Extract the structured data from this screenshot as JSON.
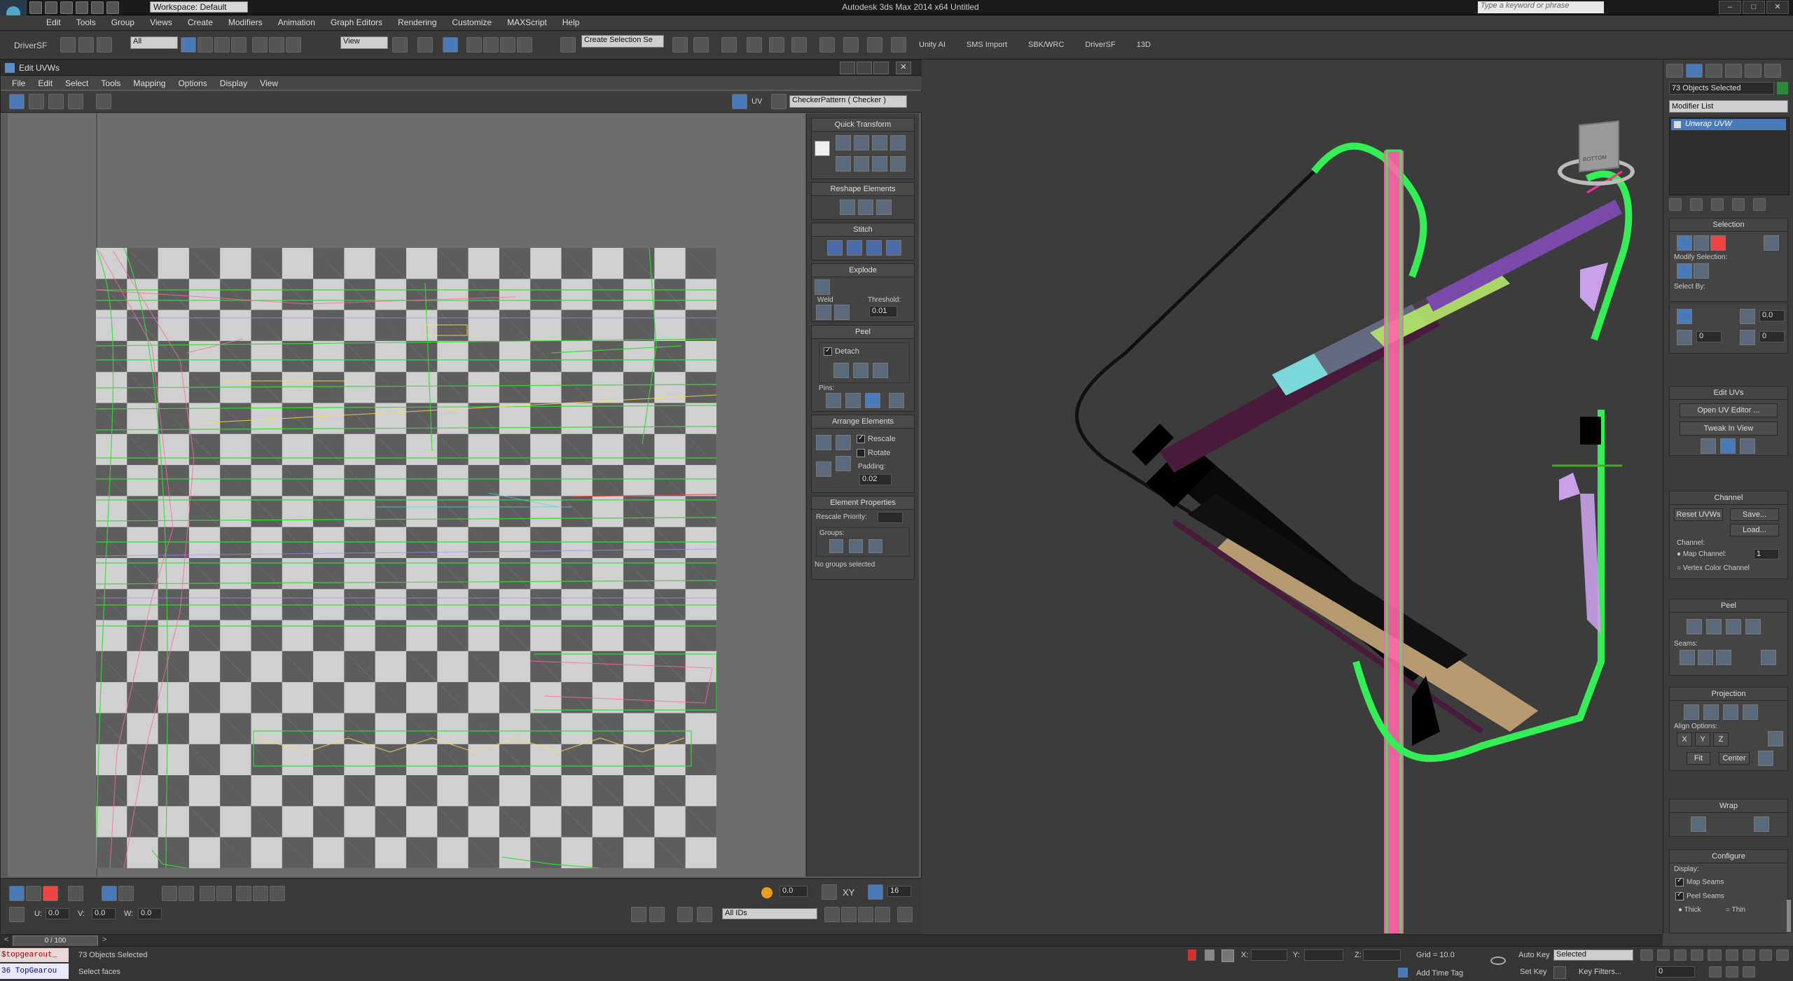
{
  "app": {
    "title": "Autodesk 3ds Max 2014 x64    Untitled",
    "workspace": "Workspace: Default",
    "search_placeholder": "Type a keyword or phrase"
  },
  "menu": [
    "Edit",
    "Tools",
    "Group",
    "Views",
    "Create",
    "Modifiers",
    "Animation",
    "Graph Editors",
    "Rendering",
    "Customize",
    "MAXScript",
    "Help"
  ],
  "toolbar": {
    "left_label": "DriverSF",
    "filter": "All",
    "view": "View",
    "selection_set": "Create Selection Se",
    "tabs": [
      "Unity AI",
      "SMS Import",
      "SBK/WRC",
      "DriverSF",
      "13D"
    ]
  },
  "uvw": {
    "title": "Edit UVWs",
    "menu": [
      "File",
      "Edit",
      "Select",
      "Tools",
      "Mapping",
      "Options",
      "Display",
      "View"
    ],
    "uv_label": "UV",
    "texture_dropdown": "CheckerPattern  ( Checker )",
    "quick_transform": "Quick Transform",
    "reshape": "Reshape Elements",
    "stitch": "Stitch",
    "explode": "Explode",
    "weld": "Weld",
    "threshold_label": "Threshold:",
    "threshold": "0.01",
    "peel": "Peel",
    "detach": "Detach",
    "pins": "Pins:",
    "arrange": "Arrange Elements",
    "rescale": "Rescale",
    "rotate": "Rotate",
    "padding_label": "Padding:",
    "padding": "0.02",
    "element_props": "Element Properties",
    "rescale_priority": "Rescale Priority:",
    "groups": "Groups:",
    "no_groups": "No groups selected",
    "bottom": {
      "value1": "0.0",
      "xy": "XY",
      "zoom": "16",
      "u_label": "U:",
      "u": "0.0",
      "v_label": "V:",
      "v": "0.0",
      "w_label": "W:",
      "w": "0.0",
      "ids": "All IDs"
    }
  },
  "command_panel": {
    "objects_selected": "73 Objects Selected",
    "modifier_list": "Modifier List",
    "stack_item": "Unwrap UVW",
    "selection": "Selection",
    "modify_selection": "Modify Selection:",
    "select_by": "Select By:",
    "sel_val1": "0.0",
    "sel_val2": "0",
    "sel_val3": "0",
    "edit_uvs": "Edit UVs",
    "open_uv_editor": "Open UV Editor ...",
    "tweak_in_view": "Tweak In View",
    "channel": "Channel",
    "reset_uvws": "Reset UVWs",
    "save": "Save...",
    "load": "Load...",
    "channel_label": "Channel:",
    "map_channel": "Map Channel:",
    "map_channel_val": "1",
    "vertex_color_channel": "Vertex Color Channel",
    "peel": "Peel",
    "seams": "Seams:",
    "projection": "Projection",
    "align_options": "Align Options:",
    "align_x": "X",
    "align_y": "Y",
    "align_z": "Z",
    "fit": "Fit",
    "center": "Center",
    "wrap": "Wrap",
    "configure": "Configure",
    "display": "Display:",
    "map_seams": "Map Seams",
    "peel_seams": "Peel Seams",
    "thick": "Thick",
    "thin": "Thin"
  },
  "status": {
    "timeline": "0 / 100",
    "script1": "$topgearout_",
    "script2": "36 TopGearou",
    "objects_selected": "73 Objects Selected",
    "prompt": "Select faces",
    "x_label": "X:",
    "y_label": "Y:",
    "z_label": "Z:",
    "grid": "Grid = 10.0",
    "add_time_tag": "Add Time Tag",
    "auto_key": "Auto Key",
    "selected": "Selected",
    "set_key": "Set Key",
    "key_filters": "Key Filters...",
    "frame": "0"
  },
  "viewcube_label": "BOTTOM"
}
